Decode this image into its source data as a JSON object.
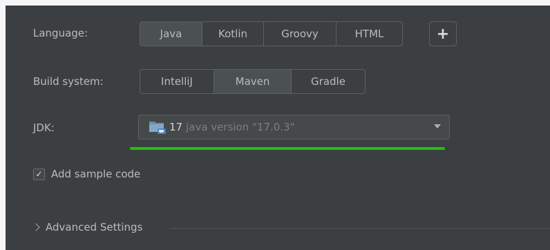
{
  "language": {
    "label": "Language:",
    "options": [
      "Java",
      "Kotlin",
      "Groovy",
      "HTML"
    ],
    "selected": "Java",
    "add_label": "+"
  },
  "build_system": {
    "label": "Build system:",
    "options": [
      "IntelliJ",
      "Maven",
      "Gradle"
    ],
    "selected": "Maven"
  },
  "jdk": {
    "label": "JDK:",
    "version": "17",
    "description": "java version \"17.0.3\"",
    "icon": "folder-icon"
  },
  "sample_code": {
    "label": "Add sample code",
    "checked": true,
    "check_glyph": "✓"
  },
  "advanced": {
    "label": "Advanced Settings"
  },
  "colors": {
    "highlight": "#20c20e",
    "panel": "#3c3f41",
    "selected_segment": "#4b5052"
  }
}
